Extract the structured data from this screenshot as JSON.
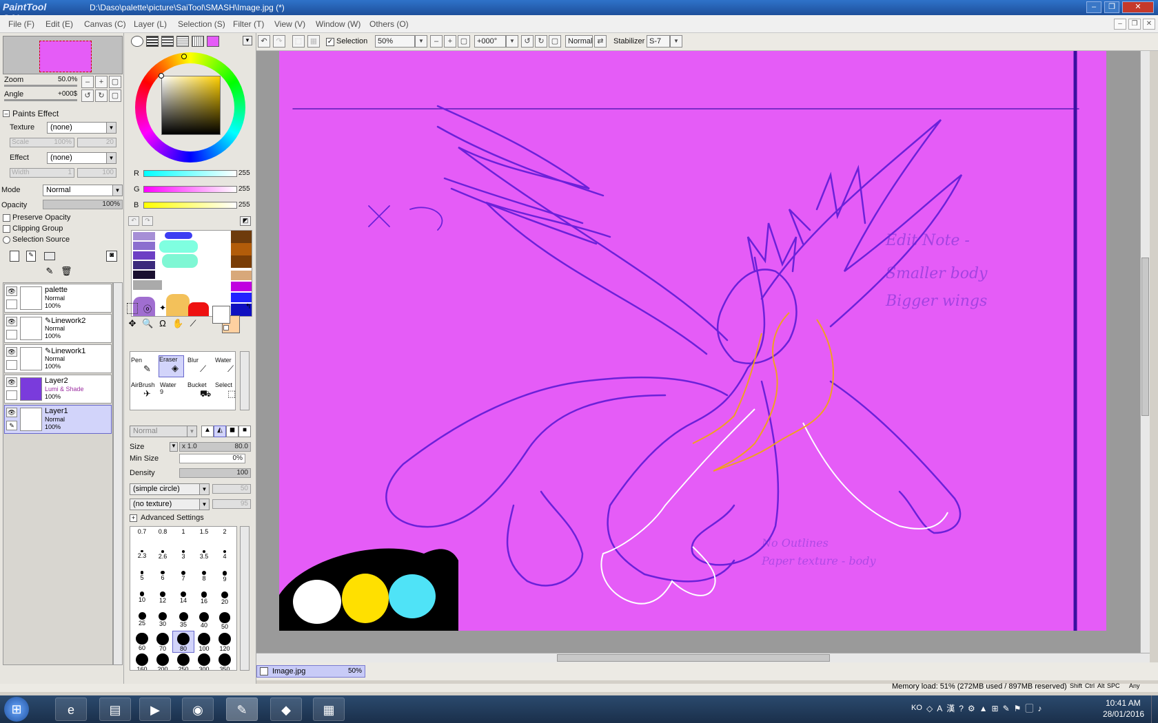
{
  "title": {
    "logo": "PaintTool SAI",
    "path": "D:\\Daso\\palette\\picture\\SaiTool\\SMASH\\Image.jpg (*)"
  },
  "menu": [
    "File (F)",
    "Edit (E)",
    "Canvas (C)",
    "Layer (L)",
    "Selection (S)",
    "Filter (T)",
    "View (V)",
    "Window (W)",
    "Others (O)"
  ],
  "navigator": {
    "zoom_label": "Zoom",
    "zoom_value": "50.0%",
    "angle_label": "Angle",
    "angle_value": "+000$"
  },
  "paints_effect": {
    "header": "Paints Effect",
    "texture_label": "Texture",
    "texture_value": "(none)",
    "scale_label": "Scale",
    "scale_value": "100%",
    "scale_num": "20",
    "effect_label": "Effect",
    "effect_value": "(none)",
    "width_label": "Width",
    "width_value": "1",
    "width_num": "100"
  },
  "layer_props": {
    "mode_label": "Mode",
    "mode_value": "Normal",
    "opacity_label": "Opacity",
    "opacity_value": "100%",
    "preserve_opacity": "Preserve Opacity",
    "clipping_group": "Clipping Group",
    "selection_source": "Selection Source"
  },
  "layers": [
    {
      "name": "palette",
      "mode": "Normal",
      "opacity": "100%"
    },
    {
      "name": "Linework2",
      "mode": "Normal",
      "opacity": "100%"
    },
    {
      "name": "Linework1",
      "mode": "Normal",
      "opacity": "100%"
    },
    {
      "name": "Layer2",
      "mode": "Lumi & Shade",
      "opacity": "100%"
    },
    {
      "name": "Layer1",
      "mode": "Normal",
      "opacity": "100%"
    }
  ],
  "color": {
    "r_label": "R",
    "r_value": "255",
    "g_label": "G",
    "g_value": "255",
    "b_label": "B",
    "b_value": "255",
    "primary": "#ffffff",
    "secondary": "#ffd0a0"
  },
  "tools": [
    {
      "name": "Pen"
    },
    {
      "name": "Eraser"
    },
    {
      "name": "Blur"
    },
    {
      "name": "Water"
    },
    {
      "name": "AirBrush"
    },
    {
      "name": "Water",
      "sub": "9"
    },
    {
      "name": "Bucket"
    },
    {
      "name": "Select"
    }
  ],
  "brush": {
    "mode": "Normal",
    "size_label": "Size",
    "size_mult": "x 1.0",
    "size_value": "80.0",
    "min_size_label": "Min Size",
    "min_size_value": "0%",
    "density_label": "Density",
    "density_value": "100",
    "shape": "(simple circle)",
    "shape_value": "50",
    "texture": "(no texture)",
    "texture_value": "95",
    "advanced": "Advanced Settings"
  },
  "brush_sizes": [
    "0.7",
    "0.8",
    "1",
    "1.5",
    "2",
    "2.3",
    "2.6",
    "3",
    "3.5",
    "4",
    "5",
    "6",
    "7",
    "8",
    "9",
    "10",
    "12",
    "14",
    "16",
    "20",
    "25",
    "30",
    "35",
    "40",
    "50",
    "60",
    "70",
    "80",
    "100",
    "120",
    "160",
    "200",
    "250",
    "300",
    "350"
  ],
  "toolbar": {
    "selection_label": "Selection",
    "zoom_value": "50%",
    "angle_value": "+000°",
    "blend_mode": "Normal",
    "stabilizer_label": "Stabilizer",
    "stabilizer_value": "S-7"
  },
  "canvas_text": {
    "edit_note": "Edit Note -",
    "smaller_body": "Smaller body",
    "bigger_wings": "Bigger wings",
    "no_outlines": "No Outlines",
    "paper_texture": "Paper texture - body"
  },
  "tab": {
    "name": "Image.jpg",
    "zoom": "50%"
  },
  "status": {
    "memory": "Memory load: 51% (272MB used / 897MB reserved)",
    "keys": [
      "Shift",
      "Ctrl",
      "Alt",
      "SPC",
      "Any"
    ]
  },
  "taskbar": {
    "time": "10:41 AM",
    "date": "28/01/2016",
    "lang": "KO"
  },
  "colors": {
    "canvas_bg": "#e55cf7",
    "sketch_line": "#6b21d9",
    "selected_layer": "#d2d4fa",
    "titlebar": "#2f73c9"
  }
}
